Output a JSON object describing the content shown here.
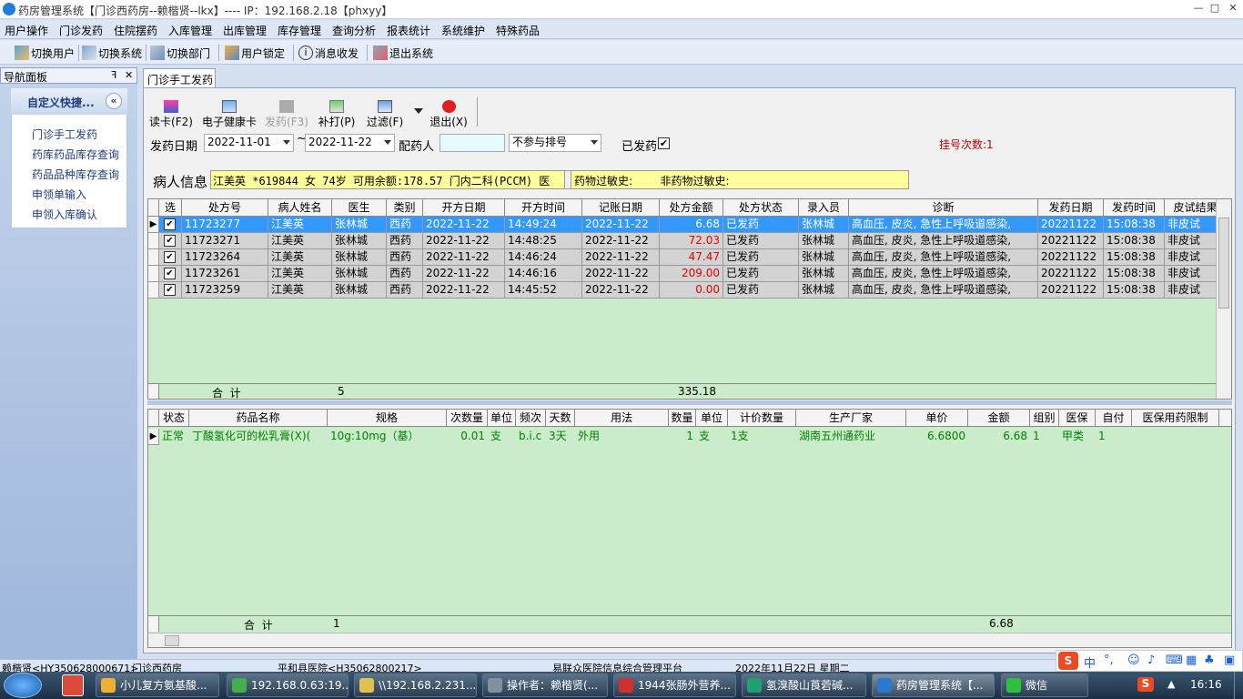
{
  "window": {
    "title": "药房管理系统【门诊西药房--赖楷贤--lkx】---- IP：192.168.2.18【phxyy】",
    "buttons": [
      "—",
      "□",
      "✕"
    ]
  },
  "menu": [
    "用户操作",
    "门诊发药",
    "住院摆药",
    "入库管理",
    "出库管理",
    "库存管理",
    "查询分析",
    "报表统计",
    "系统维护",
    "特殊药品"
  ],
  "toolbar": {
    "switch_user": "切换用户",
    "switch_system": "切换系统",
    "switch_dept": "切换部门",
    "lock_user": "用户锁定",
    "messages": "消息收发",
    "exit": "退出系统"
  },
  "nav": {
    "panel_title": "导航面板",
    "pin": "ꟻ",
    "close": "✕",
    "group_title": "自定义快捷...",
    "collapse": "«",
    "items": [
      "门诊手工发药",
      "药库药品库存查询",
      "药品品种库存查询",
      "申领单输入",
      "申领入库确认"
    ]
  },
  "tab": {
    "label": "门诊手工发药"
  },
  "actions": {
    "read_card": "读卡(F2)",
    "health_card": "电子健康卡",
    "dispense": "发药(F3)",
    "reprint": "补打(P)",
    "filter": "过滤(F)",
    "exit": "退出(X)"
  },
  "filters": {
    "date_label": "发药日期",
    "date_from": "2022-11-01",
    "tilde": "~",
    "date_to": "2022-11-22",
    "dispenser_label": "配药人",
    "dispenser_value": "",
    "queue_option": "不参与排号",
    "dispensed_label": "已发药",
    "dispensed_checked": true,
    "reg_count": "挂号次数:1"
  },
  "patient": {
    "label": "病人信息",
    "info": "江美英 *619844 女 74岁 可用余额:178.57 门内二科(PCCM) 医",
    "allergy": "药物过敏史:        非药物过敏史:"
  },
  "rx_table": {
    "columns": [
      "选",
      "处方号",
      "病人姓名",
      "医生",
      "类别",
      "开方日期",
      "开方时间",
      "记账日期",
      "处方金额",
      "处方状态",
      "录入员",
      "诊断",
      "发药日期",
      "发药时间",
      "皮试结果"
    ],
    "rows": [
      [
        "✔",
        "11723277",
        "江美英",
        "张林城",
        "西药",
        "2022-11-22",
        "14:49:24",
        "2022-11-22",
        "6.68",
        "已发药",
        "张林城",
        "高血压, 皮炎, 急性上呼吸道感染,",
        "20221122",
        "15:08:38",
        "非皮试"
      ],
      [
        "✔",
        "11723271",
        "江美英",
        "张林城",
        "西药",
        "2022-11-22",
        "14:48:25",
        "2022-11-22",
        "72.03",
        "已发药",
        "张林城",
        "高血压, 皮炎, 急性上呼吸道感染,",
        "20221122",
        "15:08:38",
        "非皮试"
      ],
      [
        "✔",
        "11723264",
        "江美英",
        "张林城",
        "西药",
        "2022-11-22",
        "14:46:24",
        "2022-11-22",
        "47.47",
        "已发药",
        "张林城",
        "高血压, 皮炎, 急性上呼吸道感染,",
        "20221122",
        "15:08:38",
        "非皮试"
      ],
      [
        "✔",
        "11723261",
        "江美英",
        "张林城",
        "西药",
        "2022-11-22",
        "14:46:16",
        "2022-11-22",
        "209.00",
        "已发药",
        "张林城",
        "高血压, 皮炎, 急性上呼吸道感染,",
        "20221122",
        "15:08:38",
        "非皮试"
      ],
      [
        "✔",
        "11723259",
        "江美英",
        "张林城",
        "西药",
        "2022-11-22",
        "14:45:52",
        "2022-11-22",
        "0.00",
        "已发药",
        "张林城",
        "高血压, 皮炎, 急性上呼吸道感染,",
        "20221122",
        "15:08:38",
        "非皮试"
      ]
    ],
    "summary": {
      "label": "合  计",
      "count": "5",
      "total": "335.18"
    },
    "amount_color": "#e00000",
    "selected_color": "#3399ff"
  },
  "drug_table": {
    "columns": [
      "状态",
      "药品名称",
      "规格",
      "次数量",
      "单位",
      "频次",
      "天数",
      "用法",
      "数量",
      "单位",
      "计价数量",
      "生产厂家",
      "单价",
      "金额",
      "组别",
      "医保",
      "自付",
      "医保用药限制"
    ],
    "rows": [
      [
        "正常",
        "丁酸氢化可的松乳膏(X)(",
        "10g:10mg（基）",
        "0.01",
        "支",
        "b.i.c",
        "3天",
        "外用",
        "1",
        "支",
        "1支",
        "湖南五州通药业",
        "6.6800",
        "6.68",
        "1",
        "甲类",
        "1",
        ""
      ]
    ],
    "summary": {
      "label": "合  计",
      "count": "1",
      "total": "6.68"
    },
    "text_color": "#008000"
  },
  "statusbar": [
    "赖楷贤<HY350628000671>",
    "门诊西药房",
    "平和县医院<H35062800217>",
    "易联众医院信息综合管理平台",
    "2022年11月22日 星期二"
  ],
  "taskbar": {
    "tasks": [
      "小儿复方氨基酸...",
      "192.168.0.63:19...",
      "\\\\192.168.2.231...",
      "操作者：赖楷贤(...",
      "1944张肠外营养...",
      "氢溴酸山莨菪碱...",
      "药房管理系统【...",
      "微信"
    ],
    "time": "16:16",
    "ime": "中"
  }
}
